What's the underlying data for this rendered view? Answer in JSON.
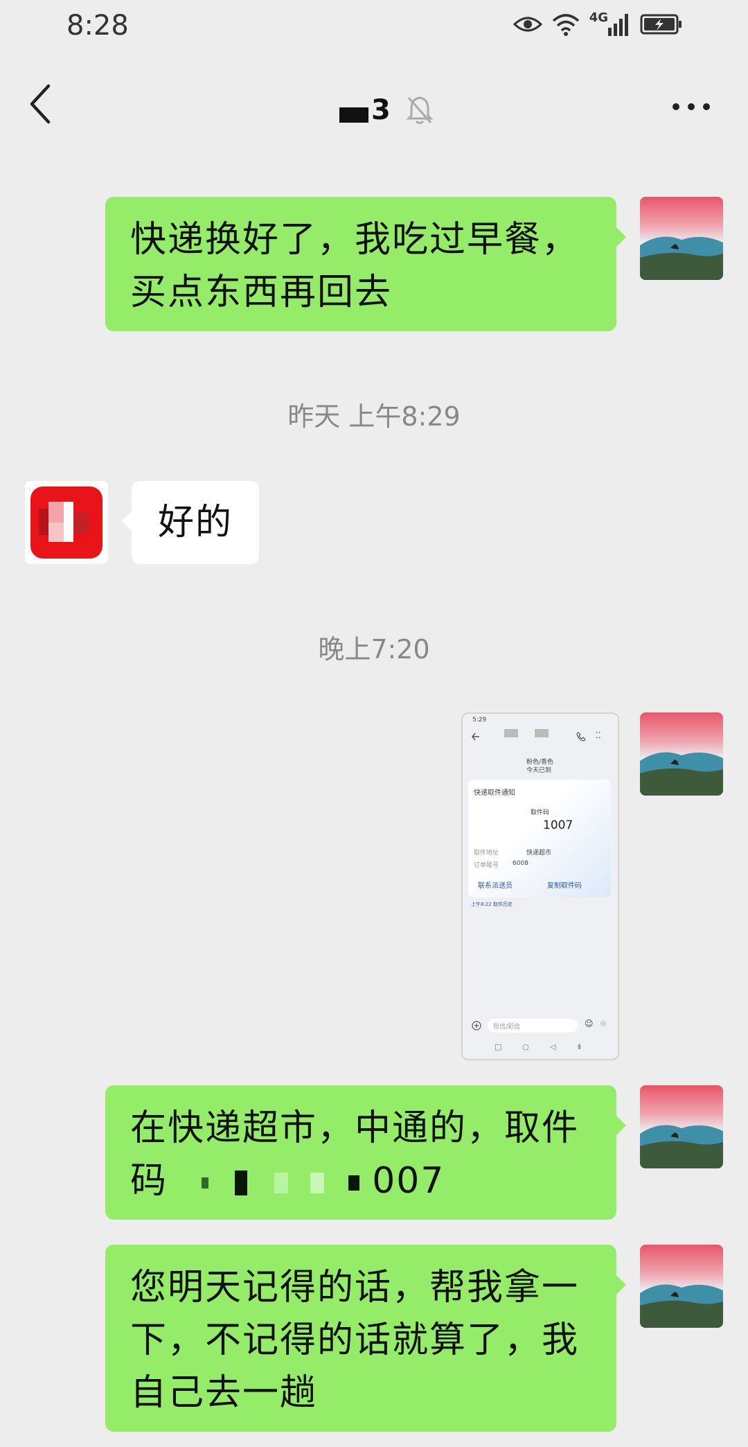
{
  "status_bar": {
    "time": "8:28",
    "network": "4G"
  },
  "header": {
    "title_visible_fragment": "3"
  },
  "messages": [
    {
      "kind": "text",
      "from": "self",
      "text_line1": "快递换好了，我吃过早餐，",
      "text_line2": "买点东西再回去"
    },
    {
      "kind": "timestamp",
      "text": "昨天 上午8:29"
    },
    {
      "kind": "text",
      "from": "friend",
      "text": "好的"
    },
    {
      "kind": "timestamp",
      "text": "晚上7:20"
    },
    {
      "kind": "image",
      "from": "self"
    },
    {
      "kind": "text",
      "from": "self",
      "text_line1": "在快递超市，中通的，取件",
      "text_line2_prefix": "码",
      "text_line2_suffix": "007"
    },
    {
      "kind": "text",
      "from": "self",
      "text_line1": "您明天记得的话，帮我拿一",
      "text_line2": "下，不记得的话就算了，我",
      "text_line3": "自己去一趟"
    }
  ],
  "screenshot_preview": {
    "time": "5:29",
    "line1": "粉色/香色",
    "line2": "今天已到",
    "card_title": "快递取件通知",
    "code_label": "取件码",
    "code_value": "1007",
    "address_label": "取件地址",
    "address_value": "快递超市",
    "order_label": "订单尾号",
    "order_value": "6008",
    "contact_label": "联系派送员",
    "copy_label": "复制取件码",
    "footer_note": "上午8:22 取件历史",
    "input_placeholder": "短信/彩信"
  },
  "colors": {
    "self_bubble": "#95ec69",
    "friend_bubble": "#ffffff",
    "background": "#ededed"
  }
}
